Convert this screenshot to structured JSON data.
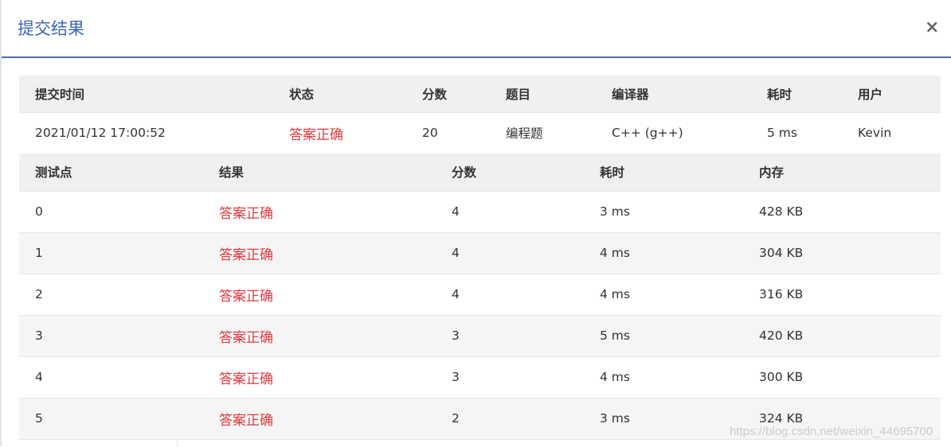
{
  "modal": {
    "title": "提交结果",
    "close_label": "×"
  },
  "summary": {
    "headers": [
      "提交时间",
      "状态",
      "分数",
      "题目",
      "编译器",
      "耗时",
      "用户"
    ],
    "row": {
      "time": "2021/01/12 17:00:52",
      "status": "答案正确",
      "score": "20",
      "problem": "编程题",
      "compiler": "C++ (g++)",
      "duration": "5 ms",
      "user": "Kevin"
    }
  },
  "tests": {
    "headers": [
      "测试点",
      "结果",
      "分数",
      "耗时",
      "内存"
    ],
    "rows": [
      {
        "id": "0",
        "result": "答案正确",
        "score": "4",
        "time": "3 ms",
        "memory": "428 KB"
      },
      {
        "id": "1",
        "result": "答案正确",
        "score": "4",
        "time": "4 ms",
        "memory": "304 KB"
      },
      {
        "id": "2",
        "result": "答案正确",
        "score": "4",
        "time": "4 ms",
        "memory": "316 KB"
      },
      {
        "id": "3",
        "result": "答案正确",
        "score": "3",
        "time": "5 ms",
        "memory": "420 KB"
      },
      {
        "id": "4",
        "result": "答案正确",
        "score": "3",
        "time": "4 ms",
        "memory": "300 KB"
      },
      {
        "id": "5",
        "result": "答案正确",
        "score": "2",
        "time": "3 ms",
        "memory": "324 KB"
      }
    ]
  },
  "watermark": "https://blog.csdn.net/weixin_44695700",
  "colors": {
    "title": "#3a67b5",
    "header_rule": "#4a6eb0",
    "accepted": "#e4393c",
    "table_header_bg": "#f0f0f0"
  },
  "icons": {
    "close": "close-icon"
  }
}
